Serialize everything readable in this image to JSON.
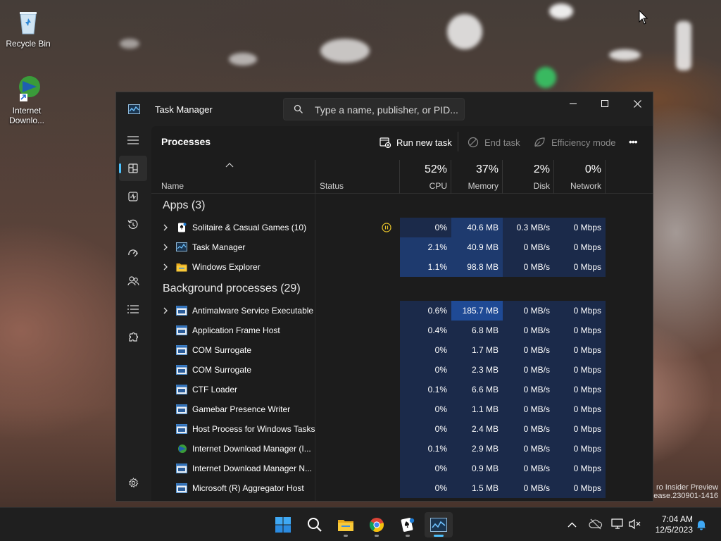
{
  "desktop": {
    "icons": [
      {
        "label": "Recycle Bin"
      },
      {
        "label": "Internet Downlo..."
      }
    ],
    "watermark": {
      "line1": "ro Insider Preview",
      "line2": "ease.230901-1416"
    }
  },
  "window": {
    "title": "Task Manager",
    "search_placeholder": "Type a name, publisher, or PID...",
    "minimize_glyph": "—",
    "maximize_glyph": "☐",
    "close_glyph": "✕"
  },
  "nav": {
    "items": [
      {
        "icon": "hamburger-menu-icon",
        "active": false
      },
      {
        "icon": "processes-icon",
        "active": true
      },
      {
        "icon": "performance-icon",
        "active": false
      },
      {
        "icon": "app-history-icon",
        "active": false
      },
      {
        "icon": "startup-apps-icon",
        "active": false
      },
      {
        "icon": "users-icon",
        "active": false
      },
      {
        "icon": "details-icon",
        "active": false
      },
      {
        "icon": "services-icon",
        "active": false
      }
    ],
    "settings_icon": "gear-icon"
  },
  "commandbar": {
    "page_title": "Processes",
    "run_new_task": "Run new task",
    "end_task": "End task",
    "efficiency_mode": "Efficiency mode",
    "more": "•••"
  },
  "columns": {
    "name": "Name",
    "status": "Status",
    "cpu": {
      "pct": "52%",
      "label": "CPU"
    },
    "memory": {
      "pct": "37%",
      "label": "Memory"
    },
    "disk": {
      "pct": "2%",
      "label": "Disk"
    },
    "network": {
      "pct": "0%",
      "label": "Network"
    }
  },
  "groups": {
    "apps": "Apps (3)",
    "background": "Background processes (29)"
  },
  "apps": [
    {
      "name": "Solitaire & Casual Games (10)",
      "icon": "solitaire-icon",
      "expandable": true,
      "status": "suspended-icon",
      "cpu": "0%",
      "memory": "40.6 MB",
      "disk": "0.3 MB/s",
      "network": "0 Mbps"
    },
    {
      "name": "Task Manager",
      "icon": "task-manager-icon",
      "expandable": true,
      "cpu": "2.1%",
      "memory": "40.9 MB",
      "disk": "0 MB/s",
      "network": "0 Mbps"
    },
    {
      "name": "Windows Explorer",
      "icon": "folder-icon",
      "expandable": true,
      "cpu": "1.1%",
      "memory": "98.8 MB",
      "disk": "0 MB/s",
      "network": "0 Mbps"
    }
  ],
  "background": [
    {
      "name": "Antimalware Service Executable",
      "icon": "app-window-icon",
      "expandable": true,
      "cpu": "0.6%",
      "memory": "185.7 MB",
      "disk": "0 MB/s",
      "network": "0 Mbps"
    },
    {
      "name": "Application Frame Host",
      "icon": "app-window-icon",
      "expandable": false,
      "cpu": "0.4%",
      "memory": "6.8 MB",
      "disk": "0 MB/s",
      "network": "0 Mbps"
    },
    {
      "name": "COM Surrogate",
      "icon": "app-window-icon",
      "expandable": false,
      "cpu": "0%",
      "memory": "1.7 MB",
      "disk": "0 MB/s",
      "network": "0 Mbps"
    },
    {
      "name": "COM Surrogate",
      "icon": "app-window-icon",
      "expandable": false,
      "cpu": "0%",
      "memory": "2.3 MB",
      "disk": "0 MB/s",
      "network": "0 Mbps"
    },
    {
      "name": "CTF Loader",
      "icon": "app-window-icon",
      "expandable": false,
      "cpu": "0.1%",
      "memory": "6.6 MB",
      "disk": "0 MB/s",
      "network": "0 Mbps"
    },
    {
      "name": "Gamebar Presence Writer",
      "icon": "app-window-icon",
      "expandable": false,
      "cpu": "0%",
      "memory": "1.1 MB",
      "disk": "0 MB/s",
      "network": "0 Mbps"
    },
    {
      "name": "Host Process for Windows Tasks",
      "icon": "app-window-icon",
      "expandable": false,
      "cpu": "0%",
      "memory": "2.4 MB",
      "disk": "0 MB/s",
      "network": "0 Mbps"
    },
    {
      "name": "Internet Download Manager (I...",
      "icon": "idm-icon",
      "expandable": false,
      "cpu": "0.1%",
      "memory": "2.9 MB",
      "disk": "0 MB/s",
      "network": "0 Mbps"
    },
    {
      "name": "Internet Download Manager N...",
      "icon": "app-window-icon",
      "expandable": false,
      "cpu": "0%",
      "memory": "0.9 MB",
      "disk": "0 MB/s",
      "network": "0 Mbps"
    },
    {
      "name": "Microsoft (R) Aggregator Host",
      "icon": "app-window-icon",
      "expandable": false,
      "cpu": "0%",
      "memory": "1.5 MB",
      "disk": "0 MB/s",
      "network": "0 Mbps"
    }
  ],
  "heat_colors": {
    "low": "#1b2a4a",
    "mid": "#1e3a6e",
    "high": "#1f4a95"
  },
  "taskbar": {
    "apps": [
      {
        "icon": "windows-start-icon"
      },
      {
        "icon": "search-icon"
      },
      {
        "icon": "file-explorer-icon"
      },
      {
        "icon": "chrome-icon"
      },
      {
        "icon": "solitaire-icon"
      },
      {
        "icon": "task-manager-icon"
      }
    ],
    "time": "7:04 AM",
    "date": "12/5/2023"
  }
}
